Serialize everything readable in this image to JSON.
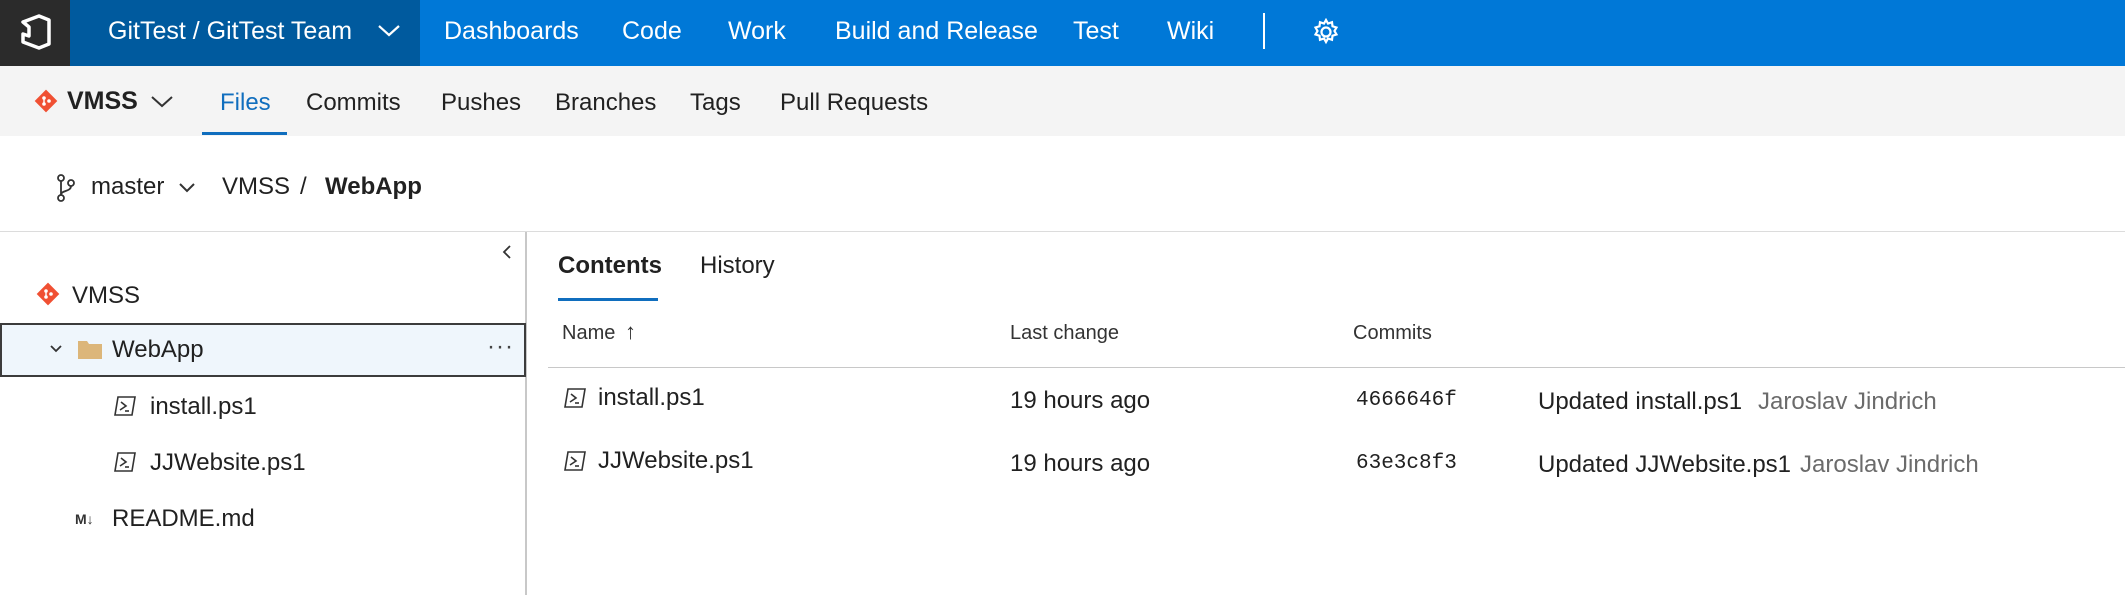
{
  "header": {
    "project_selector": "GitTest / GitTest Team",
    "nav": [
      "Dashboards",
      "Code",
      "Work",
      "Build and Release",
      "Test",
      "Wiki"
    ]
  },
  "repo_bar": {
    "repo_name": "VMSS",
    "tabs": [
      "Files",
      "Commits",
      "Pushes",
      "Branches",
      "Tags",
      "Pull Requests"
    ],
    "active_tab": "Files"
  },
  "breadcrumb": {
    "branch": "master",
    "path": [
      "VMSS",
      "/",
      "WebApp"
    ]
  },
  "tree": {
    "root": "VMSS",
    "folder": "WebApp",
    "folder_children": [
      "install.ps1",
      "JJWebsite.ps1"
    ],
    "root_files": [
      "README.md"
    ],
    "more_label": "···",
    "readme_icon_label": "M↓"
  },
  "content": {
    "tabs": [
      "Contents",
      "History"
    ],
    "active_tab": "Contents",
    "columns": {
      "name": "Name",
      "sort_arrow": "↑",
      "last_change": "Last change",
      "commits": "Commits"
    },
    "rows": [
      {
        "name": "install.ps1",
        "last_change": "19 hours ago",
        "commit": "4666646f",
        "message": "Updated install.ps1",
        "author": "Jaroslav Jindrich"
      },
      {
        "name": "JJWebsite.ps1",
        "last_change": "19 hours ago",
        "commit": "63e3c8f3",
        "message": "Updated JJWebsite.ps1",
        "author": "Jaroslav Jindrich"
      }
    ]
  },
  "colors": {
    "header_blue": "#0078d7",
    "project_blue": "#005a9e",
    "accent": "#106ebe",
    "git_orange": "#f05033"
  }
}
